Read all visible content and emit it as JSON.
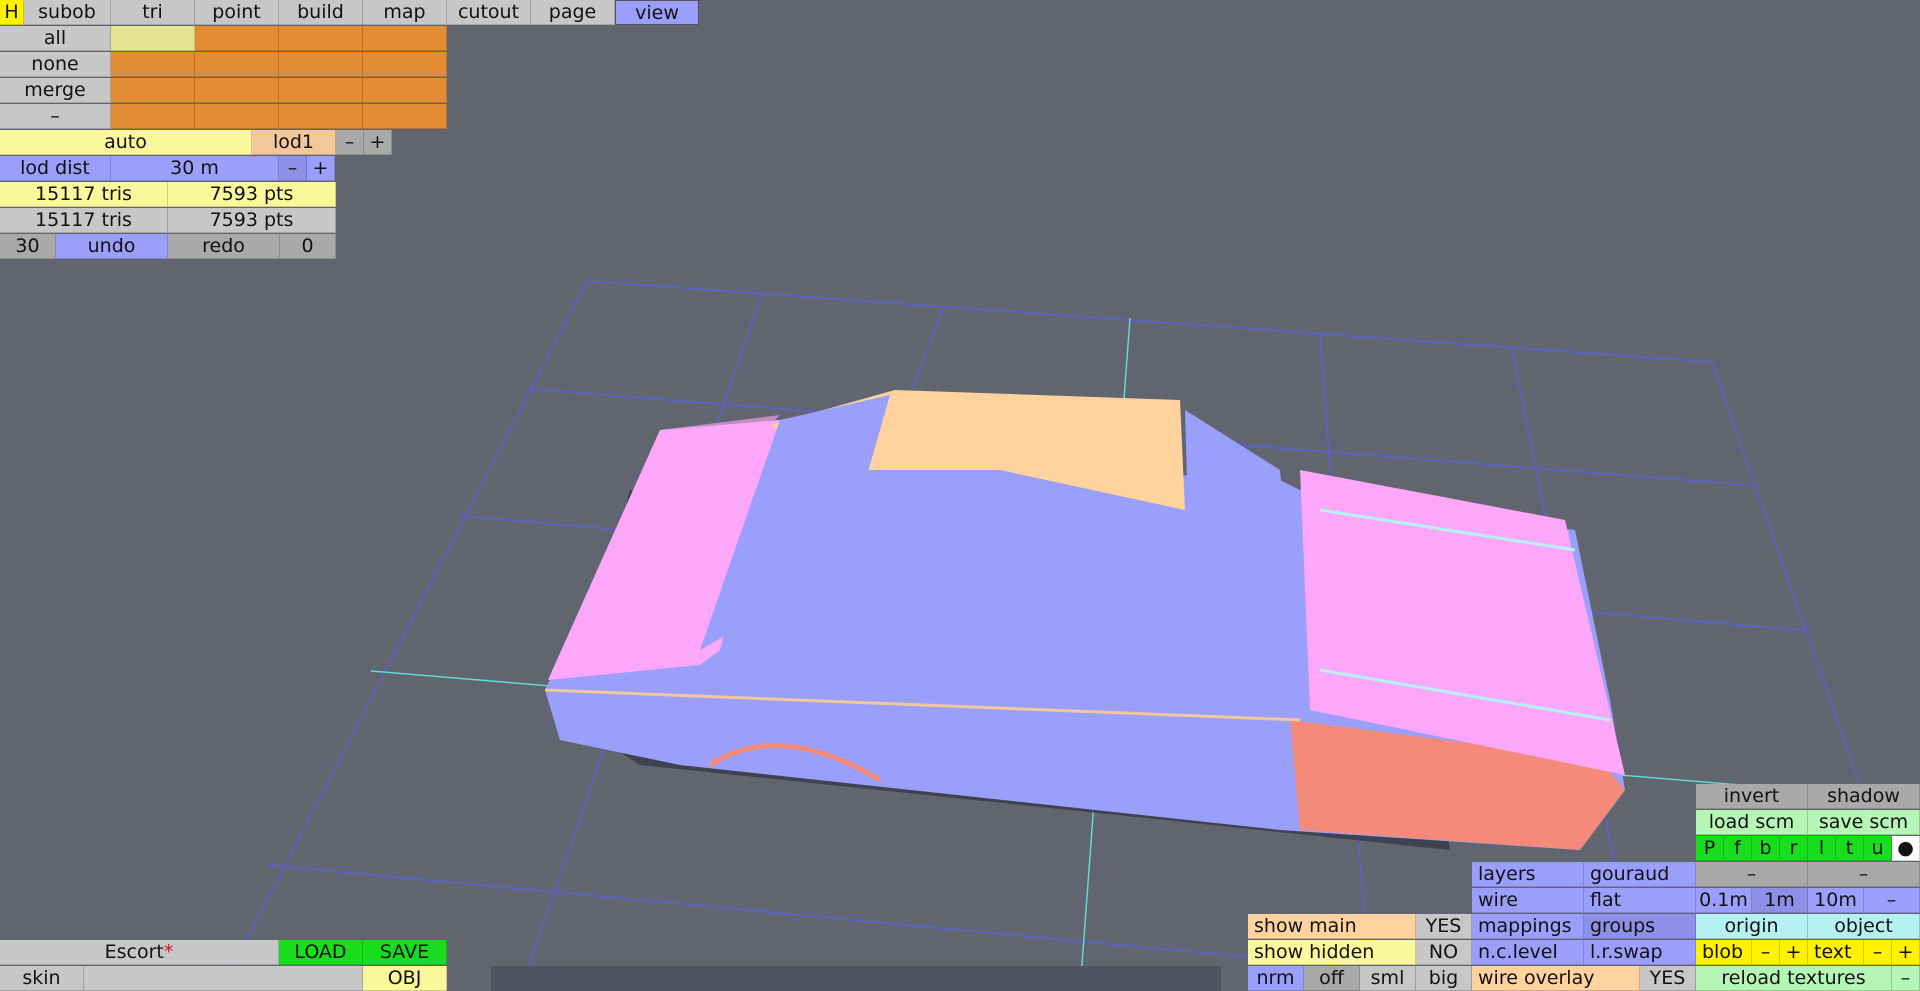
{
  "tabs": [
    "H",
    "subob",
    "tri",
    "point",
    "build",
    "map",
    "cutout",
    "page",
    "view"
  ],
  "select_rows": [
    "all",
    "none",
    "merge",
    "–"
  ],
  "lod": {
    "auto": "auto",
    "level": "lod1",
    "minus": "–",
    "plus": "+"
  },
  "lod_dist": {
    "label": "lod dist",
    "value": "30 m",
    "minus": "–",
    "plus": "+"
  },
  "counts": [
    {
      "tris": "15117 tris",
      "pts": "7593 pts"
    },
    {
      "tris": "15117 tris",
      "pts": "7593 pts"
    }
  ],
  "history": {
    "undo_count": "30",
    "undo": "undo",
    "redo": "redo",
    "redo_count": "0"
  },
  "file": {
    "name": "Escort",
    "modified_mark": "*",
    "load": "LOAD",
    "save": "SAVE",
    "skin": "skin",
    "obj": "OBJ"
  },
  "view_panel": {
    "invert": "invert",
    "shadow": "shadow",
    "load_scm": "load scm",
    "save_scm": "save scm",
    "views": [
      "P",
      "f",
      "b",
      "r",
      "l",
      "t",
      "u",
      "●"
    ],
    "layers": "layers",
    "gouraud": "gouraud",
    "dash1": "–",
    "dash2": "–",
    "wire": "wire",
    "flat": "flat",
    "g1": "0.1m",
    "g2": "1m",
    "g3": "10m",
    "g_minus": "–",
    "show_main": "show main",
    "show_main_val": "YES",
    "mappings": "mappings",
    "groups": "groups",
    "origin": "origin",
    "object": "object",
    "show_hidden": "show hidden",
    "show_hidden_val": "NO",
    "nc_level": "n.c.level",
    "lr_swap": "l.r.swap",
    "blob": "blob",
    "blob_minus": "–",
    "blob_plus": "+",
    "text": "text",
    "text_minus": "–",
    "text_plus": "+",
    "nrm": "nrm",
    "off": "off",
    "sml": "sml",
    "big": "big",
    "wire_overlay": "wire overlay",
    "wire_overlay_val": "YES",
    "reload_textures": "reload textures",
    "reload_minus": "–"
  },
  "colors": {
    "background": "#616570",
    "body_blue": "#9b9ffc",
    "roof": "#ffd29e",
    "pink": "#fca7f9",
    "salmon": "#f48b7a",
    "grid": "#5a5ee0",
    "axis": "#5fe0d8"
  }
}
